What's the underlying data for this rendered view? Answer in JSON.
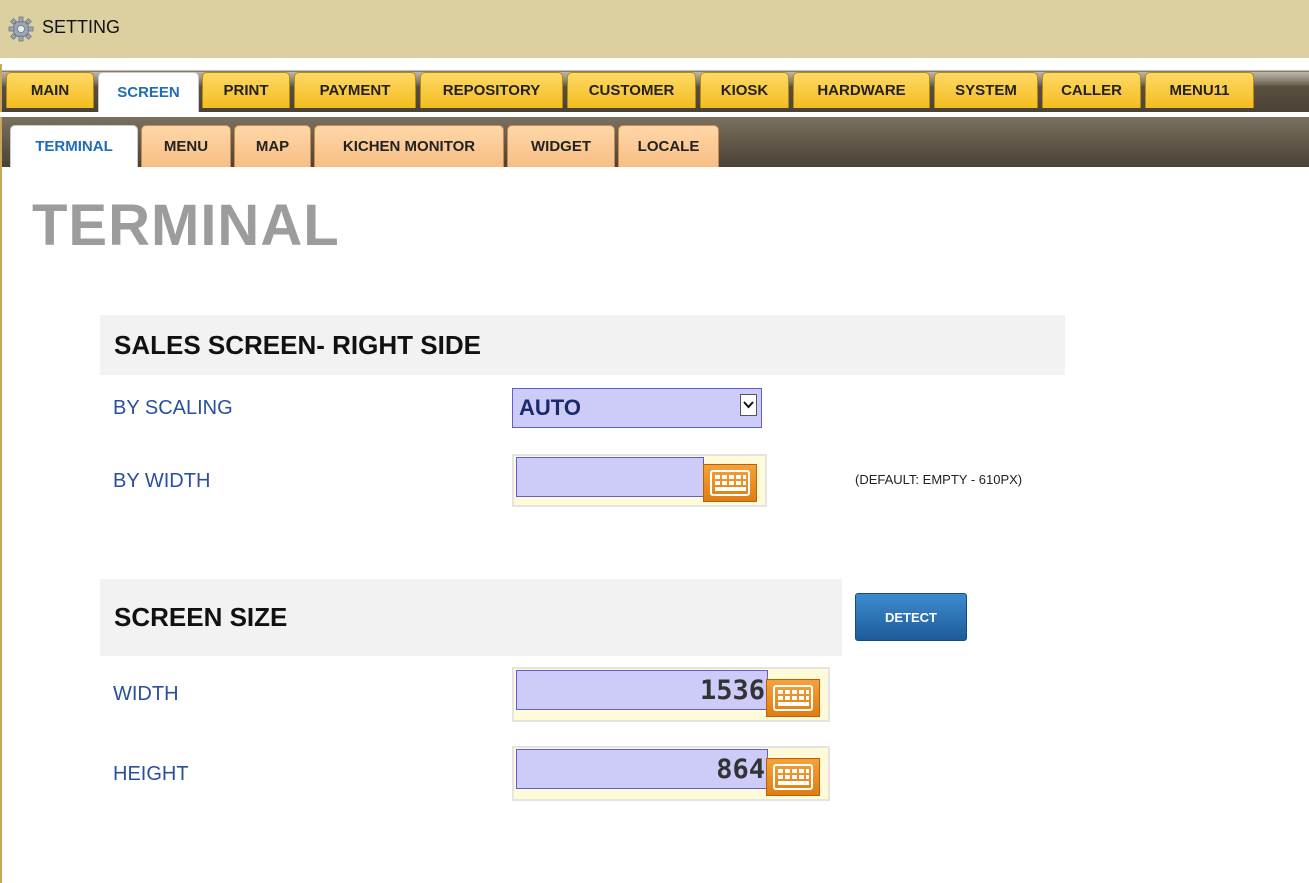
{
  "window": {
    "title": "SETTING",
    "icon": "gear-icon"
  },
  "main_tabs": [
    {
      "label": "MAIN",
      "active": false
    },
    {
      "label": "SCREEN",
      "active": true
    },
    {
      "label": "PRINT",
      "active": false
    },
    {
      "label": "PAYMENT",
      "active": false
    },
    {
      "label": "REPOSITORY",
      "active": false
    },
    {
      "label": "CUSTOMER",
      "active": false
    },
    {
      "label": "KIOSK",
      "active": false
    },
    {
      "label": "HARDWARE",
      "active": false
    },
    {
      "label": "SYSTEM",
      "active": false
    },
    {
      "label": "CALLER",
      "active": false
    },
    {
      "label": "MENU11",
      "active": false
    }
  ],
  "sub_tabs": [
    {
      "label": "TERMINAL",
      "active": true
    },
    {
      "label": "MENU",
      "active": false
    },
    {
      "label": "MAP",
      "active": false
    },
    {
      "label": "KICHEN MONITOR",
      "active": false
    },
    {
      "label": "WIDGET",
      "active": false
    },
    {
      "label": "LOCALE",
      "active": false
    }
  ],
  "page": {
    "heading": "TERMINAL"
  },
  "sales_screen": {
    "section_title": "SALES SCREEN- RIGHT SIDE",
    "by_scaling": {
      "label": "BY SCALING",
      "value": "AUTO"
    },
    "by_width": {
      "label": "BY WIDTH",
      "value": "",
      "hint": "(DEFAULT: EMPTY - 610PX)"
    }
  },
  "screen_size": {
    "section_title": "SCREEN SIZE",
    "detect_label": "DETECT",
    "width": {
      "label": "WIDTH",
      "value": "1536"
    },
    "height": {
      "label": "HEIGHT",
      "value": "864"
    }
  },
  "colors": {
    "titlebar": "#ddd0a0",
    "main_tab": "#f3bd1e",
    "sub_tab": "#f7be84",
    "active_tab_text": "#1f6db5",
    "label_text": "#2a4f9f",
    "input_bg": "#cdcbf8",
    "keyboard_button": "#e07d12",
    "detect_button": "#1d5b98"
  },
  "icons": {
    "keyboard": "keyboard-icon",
    "dropdown": "chevron-down-icon"
  }
}
